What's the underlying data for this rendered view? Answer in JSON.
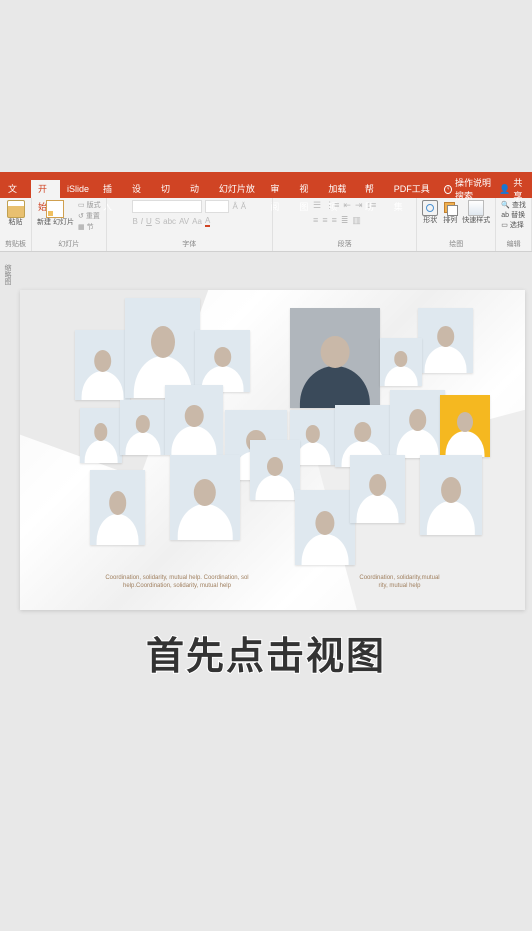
{
  "tabs": {
    "file": "文件",
    "home": "开始",
    "islide": "iSlide",
    "insert": "插入",
    "design": "设计",
    "transitions": "切换",
    "animations": "动画",
    "slideshow": "幻灯片放映",
    "review": "审阅",
    "view": "视图",
    "addins": "加载项",
    "help": "帮助",
    "pdf": "PDF工具集",
    "tell": "操作说明搜索",
    "share": "共享"
  },
  "ribbon": {
    "clipboard": {
      "paste": "粘贴",
      "group": "剪贴板"
    },
    "slides": {
      "new": "新建\n幻灯片",
      "layout": "版式",
      "reset": "重置",
      "section": "节",
      "group": "幻灯片"
    },
    "font": {
      "group": "字体"
    },
    "paragraph": {
      "group": "段落"
    },
    "drawing": {
      "shapes": "形状",
      "arrange": "排列",
      "quick": "快速样式",
      "group": "绘图"
    },
    "editing": {
      "find": "查找",
      "replace": "替换",
      "select": "选择",
      "group": "编辑"
    }
  },
  "sidebar": {
    "thumbnails": "缩略图"
  },
  "slide": {
    "caption1": "Coordination, solidarity, mutual help. Coordination, sol",
    "caption1b": "help.Coordination, solidarity, mutual help",
    "caption2": "Coordination, solidarity,mutual",
    "caption2b": "rity, mutual help"
  },
  "subtitle": "首先点击视图"
}
